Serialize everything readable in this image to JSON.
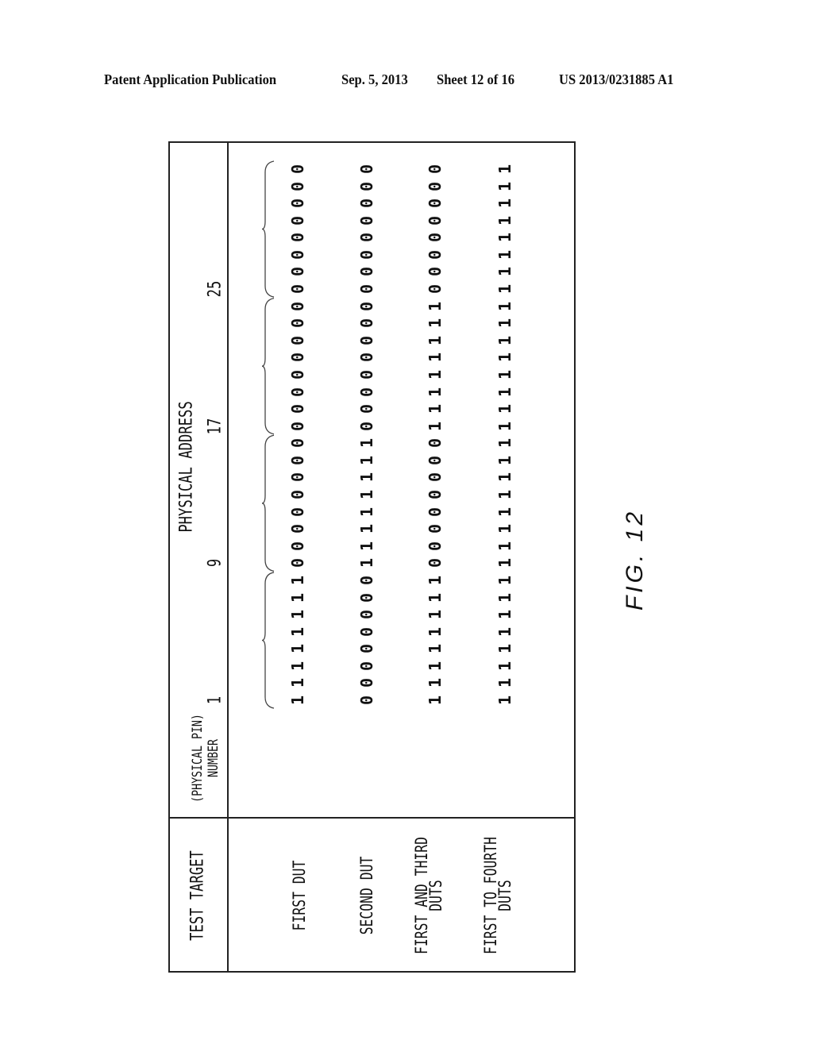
{
  "header": {
    "publication": "Patent Application Publication",
    "date": "Sep. 5, 2013",
    "sheet": "Sheet 12 of 16",
    "number": "US 2013/0231885 A1"
  },
  "table": {
    "col_header_left": "TEST TARGET",
    "physical_address_label": "PHYSICAL ADDRESS",
    "pin_label_line1": "PHYSICAL PIN",
    "pin_label_line2": "NUMBER",
    "pin_ticks": [
      "1",
      "9",
      "17",
      "25"
    ],
    "pin_count": 32,
    "group_size": 8,
    "rows": [
      {
        "target": [
          "FIRST DUT"
        ],
        "bits": "11111111000000000000000000000000"
      },
      {
        "target": [
          "SECOND DUT"
        ],
        "bits": "00000000111111110000000000000000"
      },
      {
        "target": [
          "FIRST AND THIRD",
          "DUTS"
        ],
        "bits": "11111111000000001111111100000000"
      },
      {
        "target": [
          "FIRST TO FOURTH",
          "DUTS"
        ],
        "bits": "11111111111111111111111111111111"
      }
    ]
  },
  "figure_label": "FIG. 12"
}
